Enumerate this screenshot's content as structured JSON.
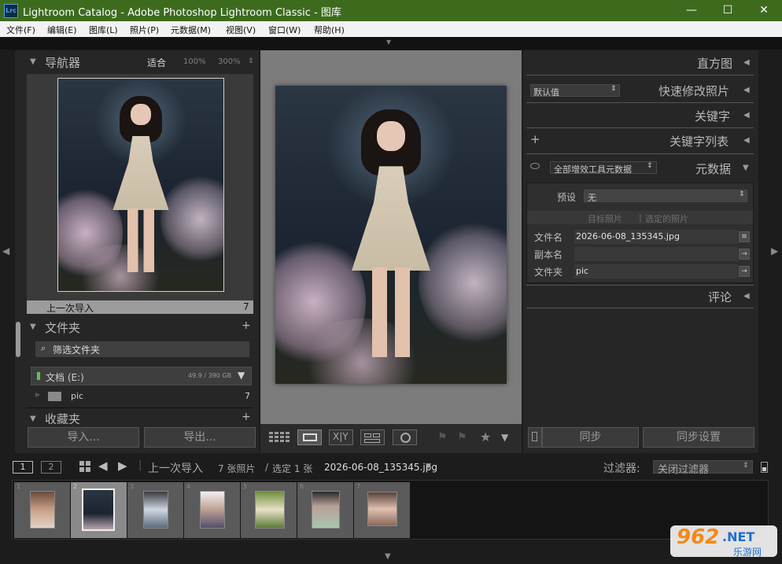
{
  "window": {
    "app_icon_text": "Lrc",
    "title": "Lightroom Catalog - Adobe Photoshop Lightroom Classic - 图库",
    "minimize": "—",
    "maximize": "☐",
    "close": "✕"
  },
  "menu": [
    "文件(F)",
    "编辑(E)",
    "图库(L)",
    "照片(P)",
    "元数据(M)",
    "视图(V)",
    "窗口(W)",
    "帮助(H)"
  ],
  "navigator": {
    "title": "导航器",
    "zoom_fit": "适合",
    "zoom_100": "100%",
    "zoom_300": "300%"
  },
  "catalog": {
    "previous_import_label": "上一次导入",
    "previous_import_count": "7"
  },
  "folders": {
    "title": "文件夹",
    "filter_placeholder": "筛选文件夹",
    "drive_name": "文档 (E:)",
    "drive_usage": "49.9 / 390 GB",
    "folder_name": "pic",
    "folder_count": "7"
  },
  "collections": {
    "title": "收藏夹"
  },
  "left_buttons": {
    "import": "导入...",
    "export": "导出..."
  },
  "right_panel": {
    "histogram": "直方图",
    "quick_develop": "快速修改照片",
    "quick_develop_preset": "默认值",
    "keywording": "关键字",
    "keyword_list": "关键字列表",
    "metadata": "元数据",
    "metadata_set": "全部增效工具元数据",
    "preset_label": "预设",
    "preset_value": "无",
    "target_photo": "目标照片",
    "selected_photo": "选定的照片",
    "filename_label": "文件名",
    "filename_value": "2026-06-08_135345.jpg",
    "copyname_label": "副本名",
    "copyname_value": "",
    "folder_label": "文件夹",
    "folder_value": "pic",
    "comments": "评论",
    "sync": "同步",
    "sync_settings": "同步设置"
  },
  "filmstrip": {
    "view1": "1",
    "view2": "2",
    "source": "上一次导入",
    "summary_count": "7 张照片",
    "summary_sep": "/",
    "summary_selected": "选定 1 张",
    "current_file": "2026-06-08_135345.jpg",
    "filter_label": "过滤器:",
    "filter_value": "关闭过滤器",
    "thumbs": [
      "1",
      "2",
      "3",
      "4",
      "5",
      "6",
      "7"
    ]
  },
  "watermark": {
    "brand": "962",
    "suffix": ".NET",
    "sub": "乐游网"
  },
  "colors": {
    "titlebar": "#3d6b1e",
    "panel": "#262626",
    "center_bg": "#7c7c7c",
    "selected_thumb": "#8a8a8a",
    "watermark_orange": "#f08a1c",
    "watermark_blue": "#1f6fd1"
  }
}
